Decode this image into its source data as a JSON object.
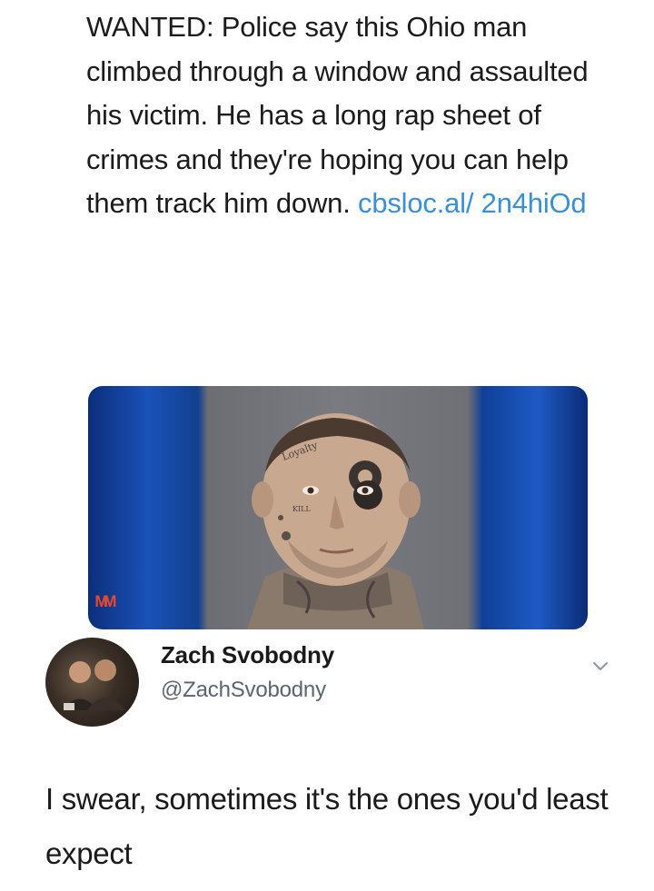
{
  "post": {
    "text": "WANTED: Police say this Ohio man climbed through a window and assaulted his victim. He has a long rap sheet of crimes and they're hoping you can help them track him down. ",
    "link": "cbsloc.al/ 2n4hiOd"
  },
  "media": {
    "logo_text": "ᴹᴹ",
    "accent_color": "#e7472f"
  },
  "tweet": {
    "display_name": "Zach Svobodny",
    "handle": "@ZachSvobodny",
    "text": "I swear, sometimes it's the ones you'd least expect",
    "menu_icon": "chevron-down-icon"
  }
}
